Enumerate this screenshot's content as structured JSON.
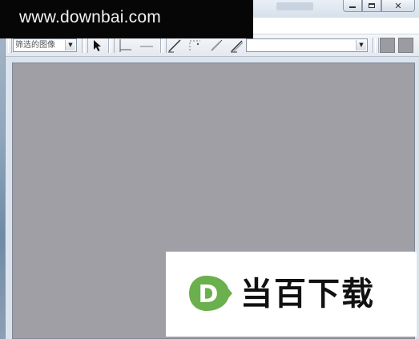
{
  "watermark_top": {
    "text": "www.downbai.com"
  },
  "watermark_bottom": {
    "text": "当百下载",
    "logo_letter": "D",
    "logo_color": "#6ab04c"
  },
  "toolbar": {
    "filter_combo_value": "筛选的图像",
    "tools": [
      "pointer-icon",
      "crop-icon",
      "line-icon",
      "draw-icon",
      "dotted-icon",
      "pen-icon",
      "brush-icon"
    ],
    "swatch_color": "#9b9ba1"
  },
  "window": {
    "controls": [
      "minimize-icon",
      "maximize-icon",
      "close-icon"
    ]
  },
  "canvas": {
    "color": "#a09fa5"
  }
}
